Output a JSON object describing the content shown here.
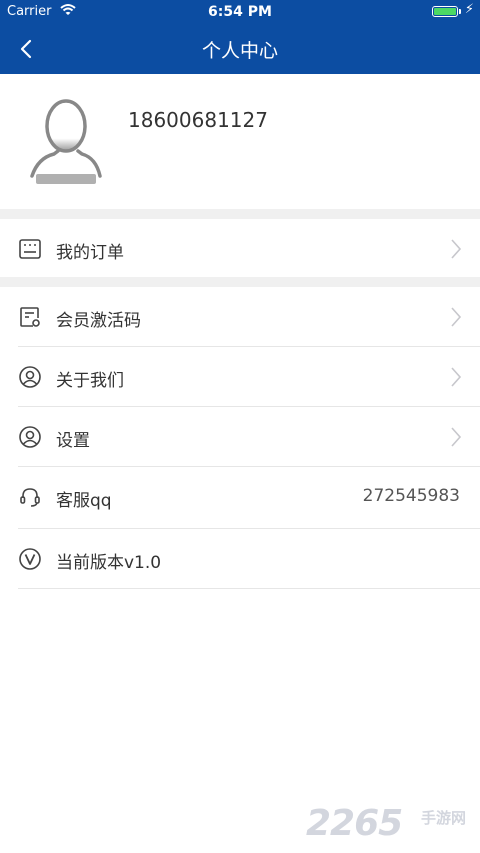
{
  "status_bar": {
    "carrier": "Carrier",
    "time": "6:54 PM"
  },
  "nav": {
    "title": "个人中心"
  },
  "profile": {
    "phone": "18600681127"
  },
  "menu": [
    {
      "label": "我的订单",
      "icon": "order-list-icon"
    },
    {
      "label": "会员激活码",
      "icon": "activation-code-icon"
    },
    {
      "label": "关于我们",
      "icon": "user-circle-icon"
    },
    {
      "label": "设置",
      "icon": "user-circle-icon"
    },
    {
      "label": "客服qq",
      "value": "272545983",
      "icon": "headset-icon"
    },
    {
      "label": "当前版本v1.0",
      "icon": "version-v-icon"
    }
  ],
  "watermark": {
    "number": "2265",
    "text": "手游网"
  },
  "colors": {
    "primary": "#0c4da2",
    "separator": "#f0f0f0",
    "text": "#333333"
  }
}
